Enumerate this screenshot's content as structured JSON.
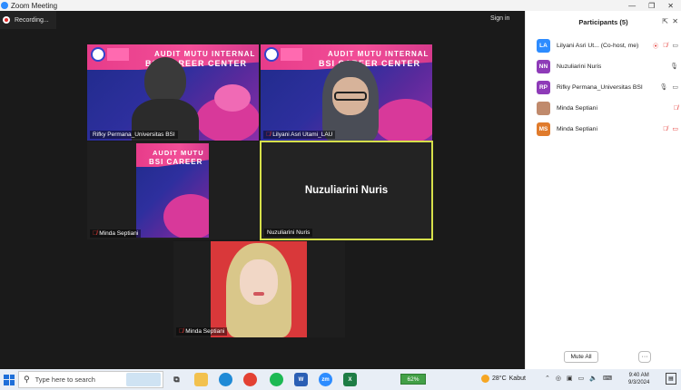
{
  "window": {
    "title": "Zoom Meeting",
    "controls": [
      "—",
      "❐",
      "✕"
    ]
  },
  "meeting": {
    "recording_label": "Recording...",
    "signin_label": "Sign in",
    "tiles": [
      {
        "label": "Rifky Permana_Universitas BSI",
        "muted": false
      },
      {
        "label": "Lilyani Asri Utami_LAU",
        "muted": true
      },
      {
        "label": "Minda Septiani",
        "muted": true
      },
      {
        "label": "Nuzuliarini Nuris",
        "display_name": "Nuzuliarini Nuris",
        "muted": false,
        "active_speaker": true
      },
      {
        "label": "Minda Septiani",
        "muted": true
      }
    ],
    "banner": {
      "line1": "AUDIT MUTU INTERNAL",
      "line2": "BSI CAREER CENTER",
      "partial1": "AUDIT MUTU",
      "partial2": "BSI CAREER"
    }
  },
  "participants": {
    "title": "Participants (5)",
    "list": [
      {
        "initials": "LA",
        "name": "Lilyani Asri Ut...  (Co-host, me)",
        "color": "#2d8cff",
        "recording": true,
        "mic": "off",
        "cam": "on"
      },
      {
        "initials": "NN",
        "name": "Nuzuliarini Nuris",
        "color": "#8e3bb8",
        "mic": "on",
        "cam": "none"
      },
      {
        "initials": "RP",
        "name": "Rifky Permana_Universitas BSI",
        "color": "#8e3bb8",
        "mic": "on",
        "cam": "on"
      },
      {
        "initials": "",
        "name": "Minda Septiani",
        "color": "#b77a5a",
        "mic": "off",
        "cam": "none"
      },
      {
        "initials": "MS",
        "name": "Minda Septiani",
        "color": "#e07b2c",
        "mic": "off",
        "cam": "off"
      }
    ],
    "mute_all_label": "Mute All",
    "more_label": "···"
  },
  "taskbar": {
    "search_placeholder": "Type here to search",
    "battery": "62%",
    "temperature": "28°C",
    "weather_text": "Kabut",
    "time": "9:40 AM",
    "date": "9/3/2024"
  }
}
